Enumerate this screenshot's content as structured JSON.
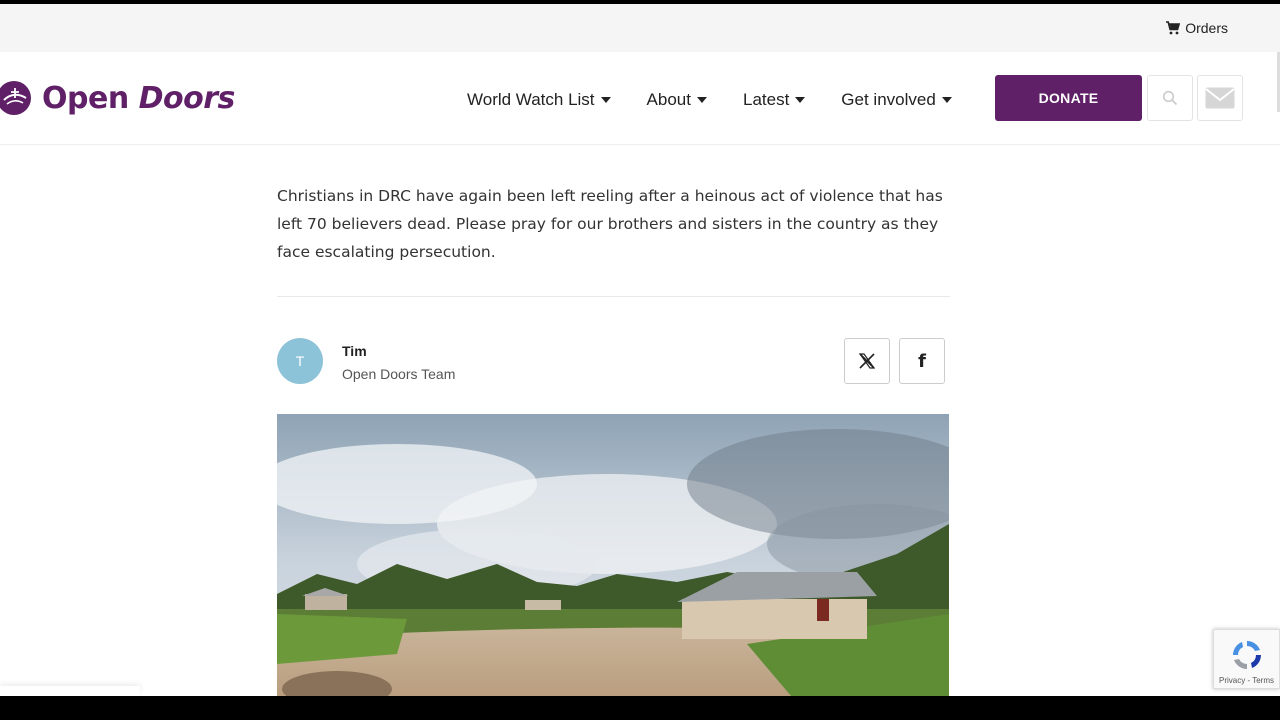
{
  "topbar": {
    "orders_label": "Orders",
    "orders_icon": "cart-icon"
  },
  "brand": {
    "name_part1": "Open",
    "name_part2": "Doors",
    "color": "#5f2067"
  },
  "nav": {
    "items": [
      {
        "label": "World Watch List"
      },
      {
        "label": "About"
      },
      {
        "label": "Latest"
      },
      {
        "label": "Get involved"
      }
    ],
    "donate_label": "DONATE",
    "search_icon": "search-icon",
    "mail_icon": "mail-icon"
  },
  "article": {
    "intro": "Christians in DRC have again been left reeling after a heinous act of violence that has left 70 believers dead. Please pray for our brothers and sisters in the country as they face escalating persecution.",
    "author": {
      "initial": "T",
      "name": "Tim",
      "role": "Open Doors Team",
      "avatar_color": "#8cc3d8"
    },
    "share": [
      {
        "network": "X",
        "icon": "x-icon"
      },
      {
        "network": "Facebook",
        "icon": "facebook-icon",
        "glyph": "f"
      }
    ]
  },
  "recaptcha": {
    "links": "Privacy - Terms"
  }
}
